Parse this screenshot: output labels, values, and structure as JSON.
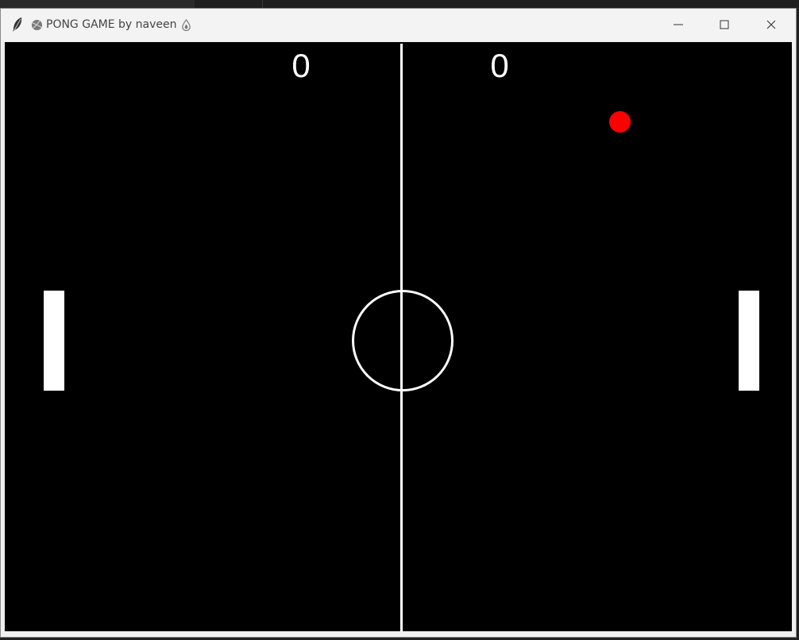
{
  "window": {
    "title": "PONG GAME by naveen",
    "title_prefix_icon": "tennis-ball-icon",
    "title_suffix_icon": "flame-icon",
    "app_icon": "feather-icon",
    "controls": [
      "minimize-icon",
      "maximize-icon",
      "close-icon"
    ]
  },
  "game": {
    "score_left": "0",
    "score_right": "0",
    "background_color": "#000000",
    "foreground_color": "#ffffff",
    "ball_color": "#ff0000"
  }
}
